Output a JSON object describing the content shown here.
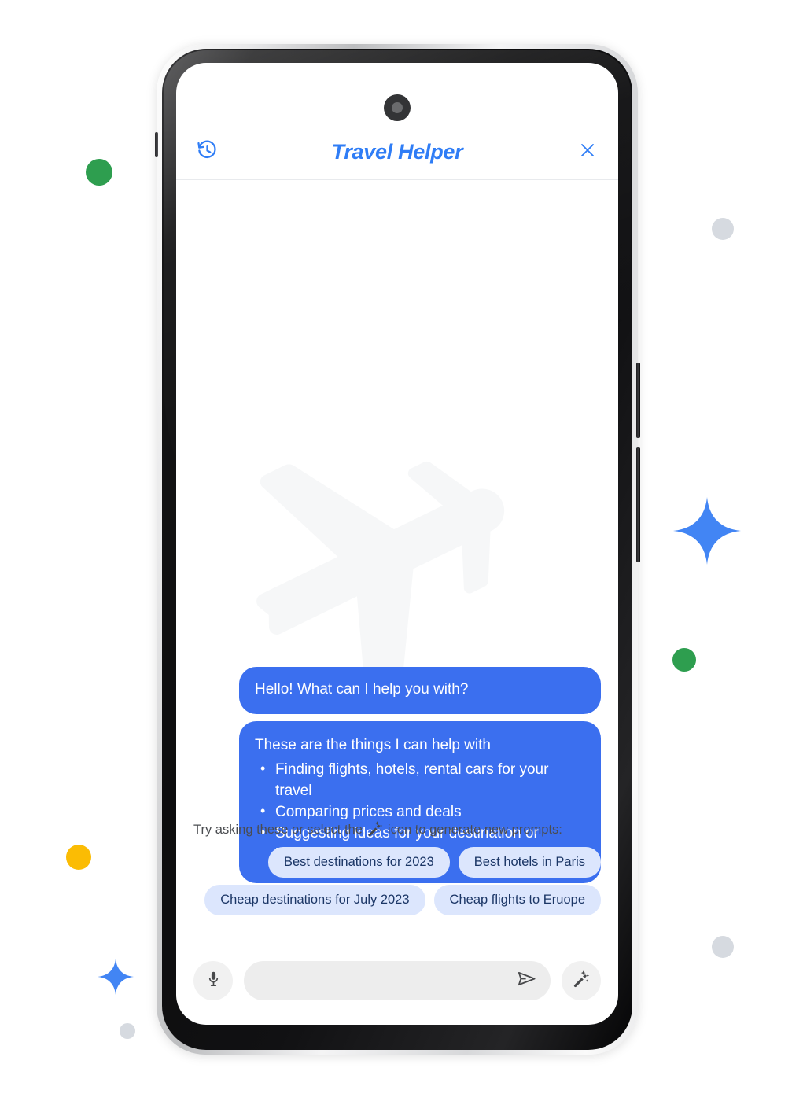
{
  "app": {
    "title": "Travel Helper",
    "accent_color": "#2F7DF6",
    "bubble_color": "#3B6FEF",
    "chip_bg_color": "#DCE6FD",
    "chip_text_color": "#1B3666"
  },
  "header": {
    "history_icon": "history-icon",
    "title": "Travel Helper",
    "close_icon": "close-icon"
  },
  "conversation": {
    "watermark_icon": "airplane-icon",
    "messages": [
      {
        "id": "greeting",
        "text": "Hello! What can I help you with?"
      },
      {
        "id": "capabilities",
        "heading": "These are the things I can help with",
        "items": [
          "Finding flights, hotels, rental cars for your travel",
          "Comparing prices and deals",
          "Suggesting ideas for your destination or itinerary"
        ]
      }
    ]
  },
  "prompts": {
    "hint_before": "Try asking these or select the",
    "hint_icon": "magic-wand-icon",
    "hint_after": "icon to generate new prompts:",
    "rows": [
      [
        "Best destinations for 2023",
        "Best hotels in Paris"
      ],
      [
        "Cheap destinations for July 2023",
        "Cheap flights to Eruope"
      ]
    ]
  },
  "input_bar": {
    "mic_icon": "microphone-icon",
    "field_value": "",
    "field_placeholder": "",
    "send_icon": "send-icon",
    "magic_icon": "magic-wand-icon"
  },
  "decorations": {
    "sparkle_color": "#4285F4",
    "green_dot_color": "#2E9E4F",
    "yellow_dot_color": "#FBBC04",
    "gray_dot_color": "#D6DAE0"
  }
}
